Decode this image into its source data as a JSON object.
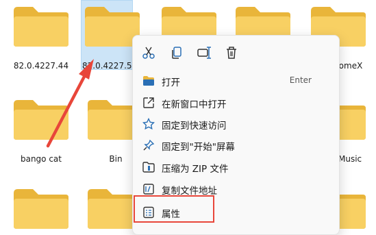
{
  "files": [
    {
      "label": "82.0.4227.44"
    },
    {
      "label": "82.0.4227.5"
    },
    {
      "label": "romeX"
    },
    {
      "label": "bango cat"
    },
    {
      "label": "Bin"
    },
    {
      "label": "Music"
    }
  ],
  "context_menu": {
    "toolbar": [
      {
        "icon": "cut-icon"
      },
      {
        "icon": "copy-icon"
      },
      {
        "icon": "rename-icon"
      },
      {
        "icon": "delete-icon"
      }
    ],
    "items": [
      {
        "label": "打开",
        "shortcut": "Enter",
        "icon": "folder-open-icon"
      },
      {
        "label": "在新窗口中打开",
        "icon": "open-new-window-icon"
      },
      {
        "label": "固定到快速访问",
        "icon": "star-icon"
      },
      {
        "label": "固定到\"开始\"屏幕",
        "icon": "pin-icon"
      },
      {
        "label": "压缩为 ZIP 文件",
        "icon": "zip-icon"
      },
      {
        "label": "复制文件地址",
        "icon": "copy-path-icon"
      },
      {
        "label": "属性",
        "icon": "properties-icon"
      }
    ]
  },
  "colors": {
    "folder": "#f5c94b",
    "highlight": "#e8463a",
    "menu_bg": "#f9f9f9"
  }
}
